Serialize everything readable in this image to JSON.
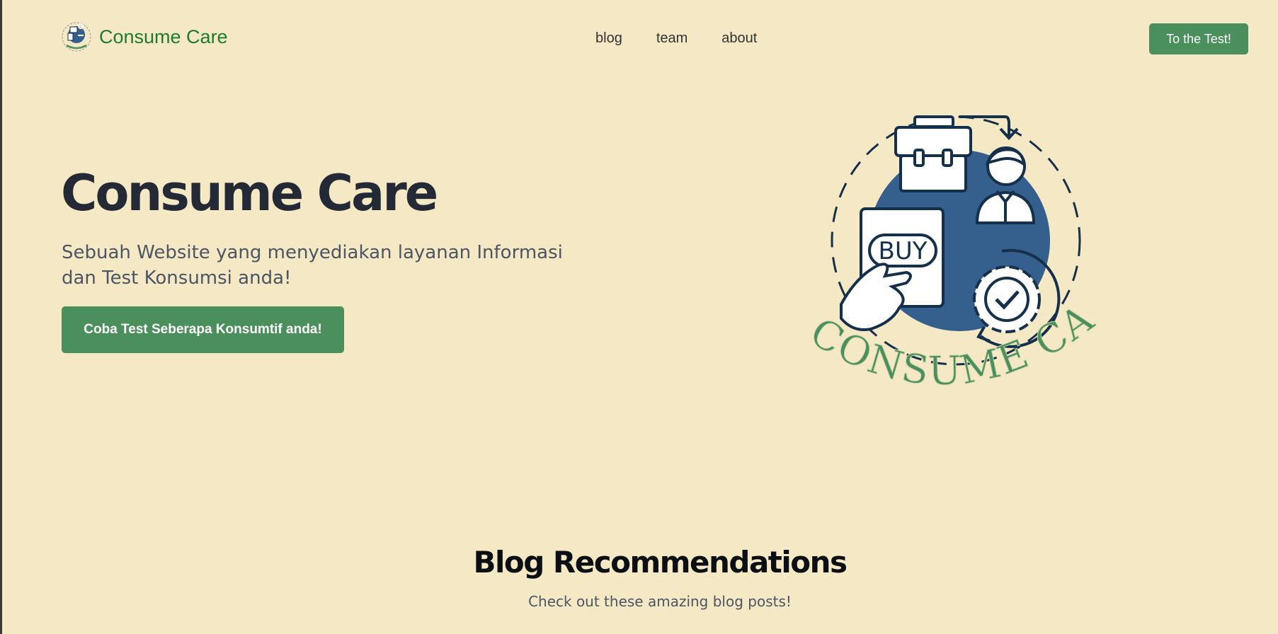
{
  "header": {
    "brand_name": "Consume Care",
    "nav": [
      {
        "label": "blog"
      },
      {
        "label": "team"
      },
      {
        "label": "about"
      }
    ],
    "cta_label": "To the Test!"
  },
  "hero": {
    "title": "Consume Care",
    "subtitle": "Sebuah Website yang menyediakan layanan Informasi dan Test Konsumsi anda!",
    "cta_label": "Coba Test Seberapa Konsumtif anda!",
    "illustration": {
      "buy_label": "BUY",
      "arc_text": "CONSUME CARE"
    }
  },
  "blog": {
    "title": "Blog Recommendations",
    "subtitle": "Check out these amazing blog posts!"
  },
  "colors": {
    "background": "#f5e8c5",
    "brand_green": "#1e7a2e",
    "button_green": "#4b8f5c",
    "illustration_blue": "#35608d",
    "illustration_navy": "#15304a"
  }
}
